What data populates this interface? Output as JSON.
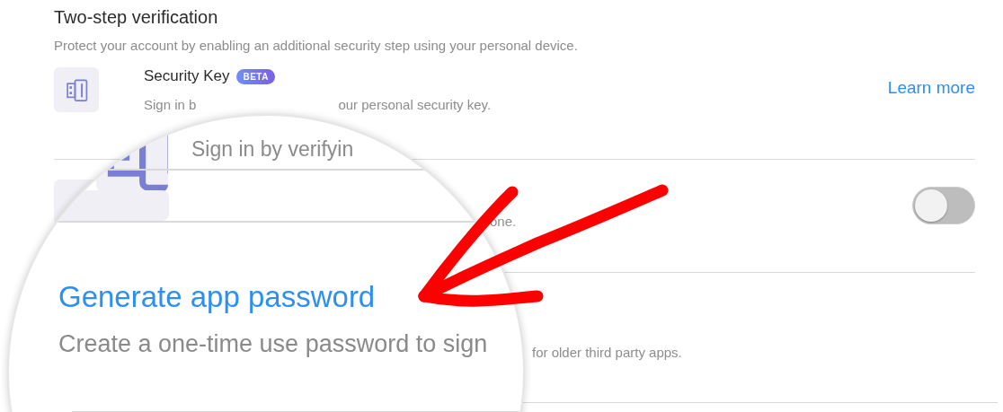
{
  "section": {
    "title": "Two-step verification",
    "description": "Protect your account by enabling an additional security step using your personal device."
  },
  "methods": [
    {
      "kind": "key",
      "title": "Security Key",
      "badge": "BETA",
      "subtitle_parts": [
        "Sign in b",
        "our personal security key."
      ],
      "link": "Learn more"
    },
    {
      "kind": "toggle",
      "subtitle_end": "one.",
      "on": false
    },
    {
      "kind": "app",
      "subtitle_end": "for older third party apps."
    }
  ],
  "magnifier": {
    "subtitle": "Sign in by verifyin",
    "link": "Generate app password",
    "description": "Create a one-time use password to sign"
  }
}
